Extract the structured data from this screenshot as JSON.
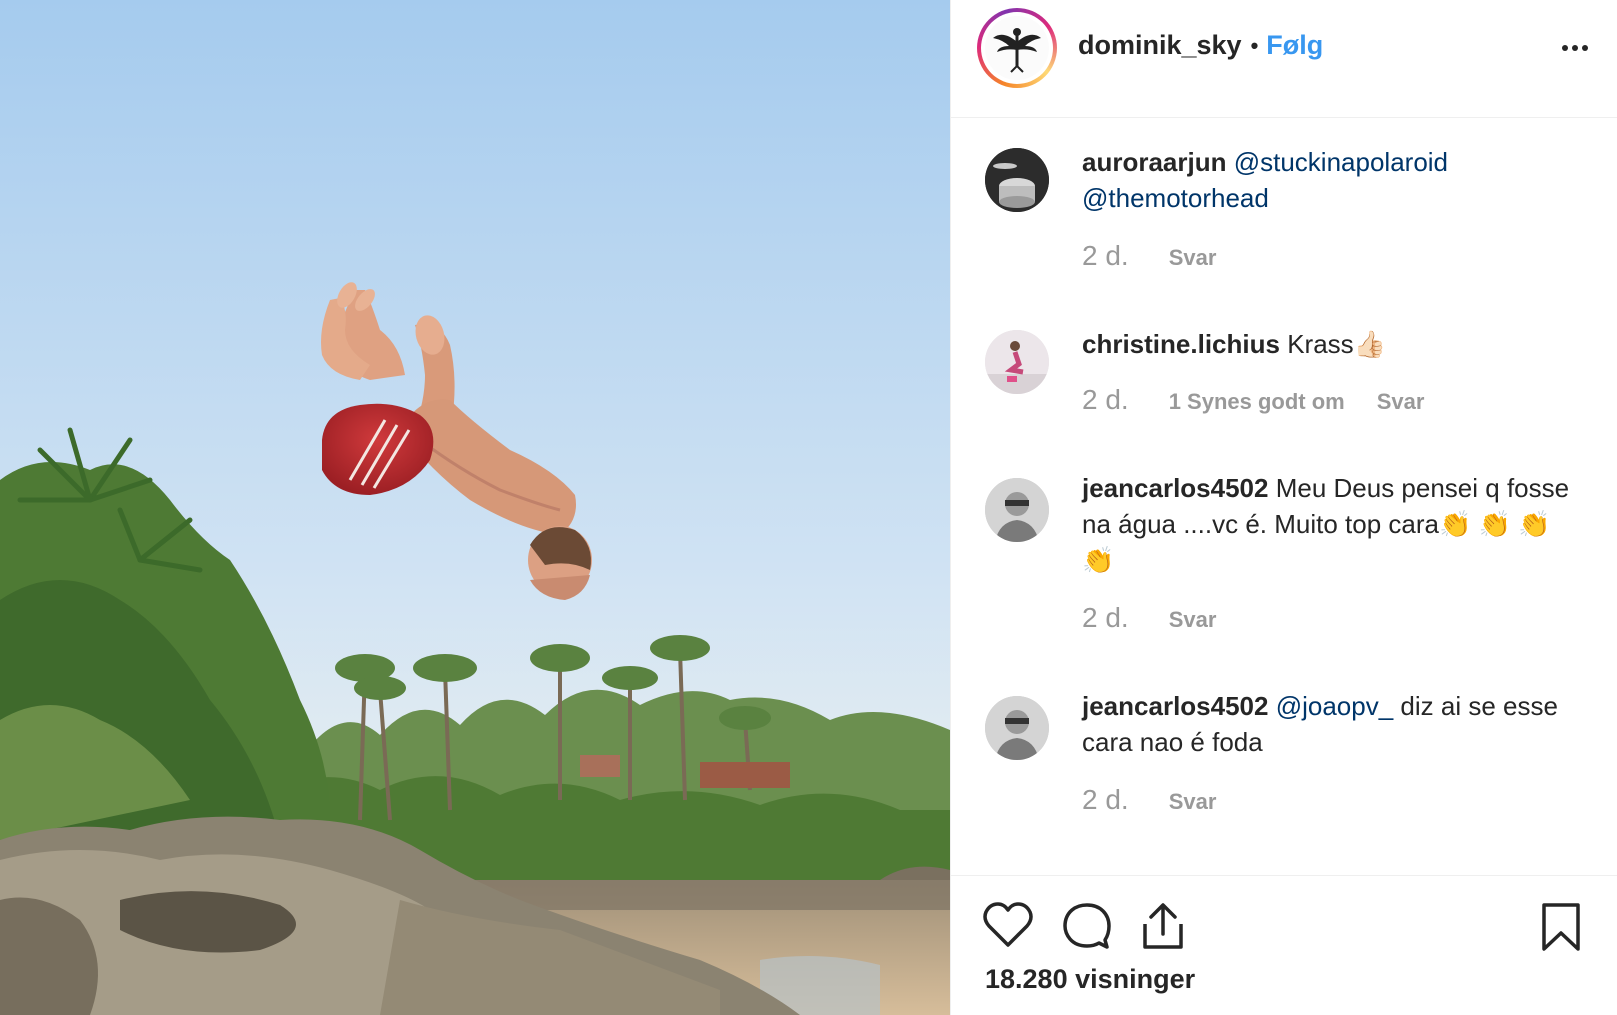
{
  "post": {
    "owner_username": "dominik_sky",
    "separator": "•",
    "follow_label": "Følg",
    "more_icon": "more-options-icon"
  },
  "media": {
    "description_kind": "video",
    "colors": {
      "sky_top": "#a9cdee",
      "sky_bottom": "#e5eef3",
      "shorts": "#b8282c",
      "skin": "#e2a585",
      "foliage": "#5c8a3a",
      "rock": "#8d8677",
      "sand": "#c9b08f"
    }
  },
  "comments": [
    {
      "username": "auroraarjun",
      "mentions": [
        "@stuckinapolaroid",
        "@themotorhead"
      ],
      "text": "",
      "time": "2 d.",
      "likes": "",
      "reply_label": "Svar"
    },
    {
      "username": "christine.lichius",
      "mentions": [],
      "text": "Krass👍🏻",
      "time": "2 d.",
      "likes": "1 Synes godt om",
      "reply_label": "Svar"
    },
    {
      "username": "jeancarlos4502",
      "mentions": [],
      "text": "Meu Deus pensei q fosse na água ....vc é. Muito top cara👏 👏 👏 👏",
      "time": "2 d.",
      "likes": "",
      "reply_label": "Svar"
    },
    {
      "username": "jeancarlos4502",
      "mentions": [
        "@joaopv_"
      ],
      "text": "diz ai se esse cara nao é foda",
      "time": "2 d.",
      "likes": "",
      "reply_label": "Svar"
    }
  ],
  "actions": {
    "like_icon": "heart-icon",
    "comment_icon": "comment-icon",
    "share_icon": "share-icon",
    "save_icon": "bookmark-icon",
    "views_label": "18.280 visninger"
  },
  "theme": {
    "text": "#262626",
    "muted": "#999999",
    "link": "#3897f0",
    "mention": "#003569",
    "border": "#efefef"
  }
}
